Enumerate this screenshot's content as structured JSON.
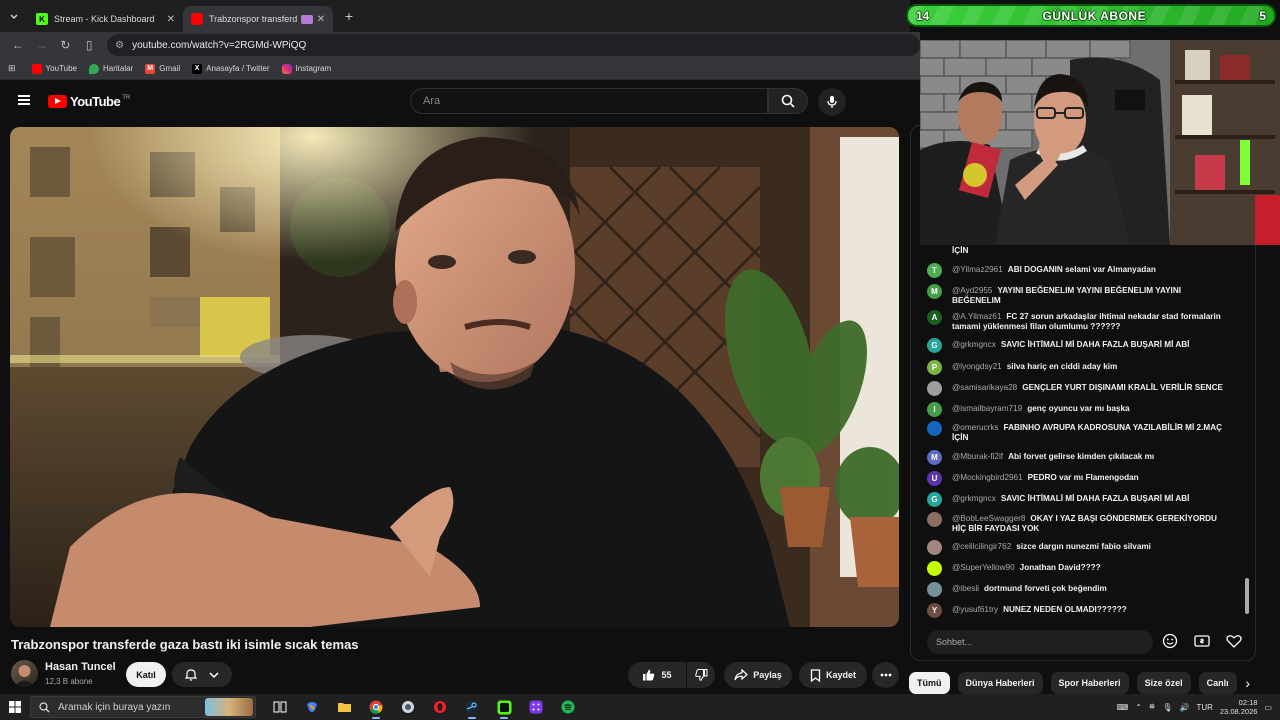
{
  "browser": {
    "tabs": [
      {
        "title": "Stream - Kick Dashboard",
        "favicon": "K",
        "favicon_color": "#53fc18",
        "active": false
      },
      {
        "title": "Trabzonspor transferde gaz",
        "favicon": "",
        "favicon_color": "#ff0000",
        "active": true
      }
    ],
    "url": "youtube.com/watch?v=2RGMd-WPiQQ",
    "bookmarks": [
      {
        "label": "YouTube",
        "color": "#ff0000"
      },
      {
        "label": "Haritalar",
        "color": "#34a853"
      },
      {
        "label": "Gmail",
        "color": "#ea4335"
      },
      {
        "label": "Anasayfa / Twitter",
        "color": "#000000"
      },
      {
        "label": "Instagram",
        "color": "#d6249f"
      }
    ]
  },
  "youtube": {
    "logo_text": "YouTube",
    "country_code": "TR",
    "search_placeholder": "Ara",
    "video_title": "Trabzonspor transferde gaza bastı iki isimle sıcak temas",
    "channel_name": "Hasan Tuncel",
    "subscribers": "12,3 B abone",
    "join_label": "Katıl",
    "like_count": "55",
    "share_label": "Paylaş",
    "save_label": "Kaydet"
  },
  "goal_bar": {
    "left_number": "14",
    "label": "GÜNLÜK ABONE",
    "right_number": "5"
  },
  "chat": {
    "partial_top_text": "İÇİN",
    "messages": [
      {
        "user": "@Yilmaz2961",
        "text": "ABI DOGANIN selami var Almanyadan",
        "avatar": "T",
        "color": "#4caf50"
      },
      {
        "user": "@Ayd2955",
        "text": "YAYINI BEĞENELIM YAYINI BEĞENELIM YAYINI BEĞENELIM",
        "avatar": "M",
        "color": "#43a047"
      },
      {
        "user": "@A.Yilmaz61",
        "text": "FC 27 sorun arkadaşlar ihtimal nekadar stad formalarin tamami yüklenmesi filan olumlumu ??????",
        "avatar": "A",
        "color": "#1b5e20"
      },
      {
        "user": "@grkmgncx",
        "text": "SAVIC İHTİMALİ Mİ DAHA FAZLA BUŞARİ Mİ ABİ",
        "avatar": "G",
        "color": "#26a69a"
      },
      {
        "user": "@lyongdsy21",
        "text": "silva hariç en ciddi aday kim",
        "avatar": "P",
        "color": "#7cb342"
      },
      {
        "user": "@samisarikaya28",
        "text": "GENÇLER YURT DIŞINAMI KRALİL VERİLİR SENCE",
        "avatar": "",
        "color": "#9e9e9e"
      },
      {
        "user": "@ismailbayram719",
        "text": "genç oyuncu var mı başka",
        "avatar": "I",
        "color": "#43a047"
      },
      {
        "user": "@omerucrks",
        "text": "FABINHO AVRUPA KADROSUNA YAZILABİLİR Mİ 2.MAÇ İÇİN",
        "avatar": "",
        "color": "#1565c0"
      },
      {
        "user": "@Mburak-fi2if",
        "text": "Abi forvet gelirse kimden çıkılacak mı",
        "avatar": "M",
        "color": "#5c6bc0"
      },
      {
        "user": "@Mockingbird2961",
        "text": "PEDRO var mı Flamengodan",
        "avatar": "U",
        "color": "#5e35b1"
      },
      {
        "user": "@grkmgncx",
        "text": "SAVIC İHTİMALİ Mİ DAHA FAZLA BUŞARİ Mİ ABİ",
        "avatar": "G",
        "color": "#26a69a"
      },
      {
        "user": "@BobLeeSwagger8",
        "text": "OKAY I YAZ BAŞI GÖNDERMEK GEREKİYORDU HİÇ BİR FAYDASI YOK",
        "avatar": "",
        "color": "#8d6e63"
      },
      {
        "user": "@celilcilingir762",
        "text": "sizce dargın nunezmi fabio silvami",
        "avatar": "",
        "color": "#a1887f"
      },
      {
        "user": "@SuperYellow90",
        "text": "Jonathan David????",
        "avatar": "",
        "color": "#c6ff00"
      },
      {
        "user": "@ibesli",
        "text": "dortmund forveti çok beğendim",
        "avatar": "",
        "color": "#78909c"
      },
      {
        "user": "@yusuf61try",
        "text": "NUNEZ NEDEN OLMADI??????",
        "avatar": "Y",
        "color": "#6d4c41"
      }
    ],
    "input_placeholder": "Sohbet..."
  },
  "chips": [
    {
      "label": "Tümü",
      "active": true
    },
    {
      "label": "Dünya Haberleri",
      "active": false
    },
    {
      "label": "Spor Haberleri",
      "active": false
    },
    {
      "label": "Size özel",
      "active": false
    },
    {
      "label": "Canlı",
      "active": false
    }
  ],
  "taskbar": {
    "search_placeholder": "Aramak için buraya yazın",
    "language": "TUR",
    "time": "02:18",
    "date": "23.08.2026"
  }
}
